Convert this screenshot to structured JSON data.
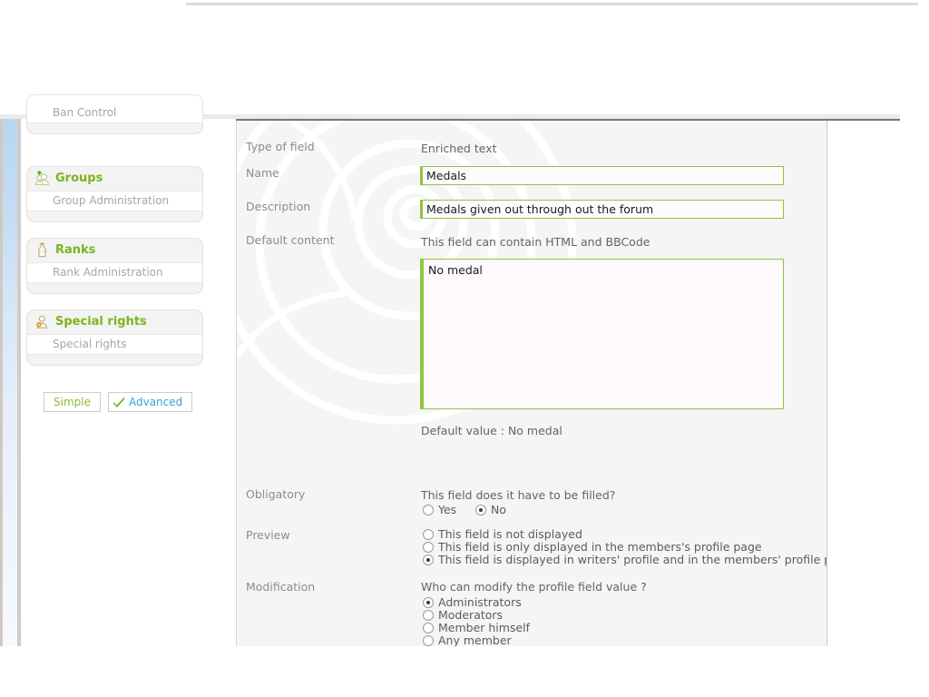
{
  "sidebar": {
    "truncated_block": {
      "item_label": "Ban Control"
    },
    "blocks": [
      {
        "icon": "groups-icon",
        "title": "Groups",
        "items": [
          "Group Administration"
        ]
      },
      {
        "icon": "rank-icon",
        "title": "Ranks",
        "items": [
          "Rank Administration"
        ]
      },
      {
        "icon": "special-rights-icon",
        "title": "Special rights",
        "items": [
          "Special rights"
        ]
      }
    ],
    "mode_buttons": {
      "simple": "Simple",
      "advanced": "Advanced",
      "advanced_icon": "green-check-icon"
    }
  },
  "form": {
    "type_of_field": {
      "label": "Type of field",
      "value": "Enriched text"
    },
    "name": {
      "label": "Name",
      "value": "Medals",
      "placeholder": ""
    },
    "description": {
      "label": "Description",
      "value": "Medals given out through out the forum",
      "placeholder": ""
    },
    "default_content": {
      "label": "Default content",
      "hint": "This field can contain HTML and BBCode",
      "value": "No medal",
      "default_value_text": "Default value : No medal"
    },
    "obligatory": {
      "label": "Obligatory",
      "question": "This field does it have to be filled?",
      "options": [
        {
          "label": "Yes",
          "selected": false
        },
        {
          "label": "No",
          "selected": true
        }
      ]
    },
    "preview": {
      "label": "Preview",
      "options": [
        {
          "label": "This field is not displayed",
          "selected": false
        },
        {
          "label": "This field is only displayed in the members's profile page",
          "selected": false
        },
        {
          "label": "This field is displayed in writers' profile and in the members' profile page",
          "selected": true
        }
      ]
    },
    "modification": {
      "label": "Modification",
      "question": "Who can modify the profile field value ?",
      "options": [
        {
          "label": "Administrators",
          "selected": true
        },
        {
          "label": "Moderators",
          "selected": false
        },
        {
          "label": "Member himself",
          "selected": false
        },
        {
          "label": "Any member",
          "selected": false
        }
      ]
    }
  },
  "colors": {
    "accent_green": "#8ec640",
    "heading_green": "#7ab51d",
    "link_blue": "#3aa0d8",
    "content_bg": "#f5f5f5"
  }
}
